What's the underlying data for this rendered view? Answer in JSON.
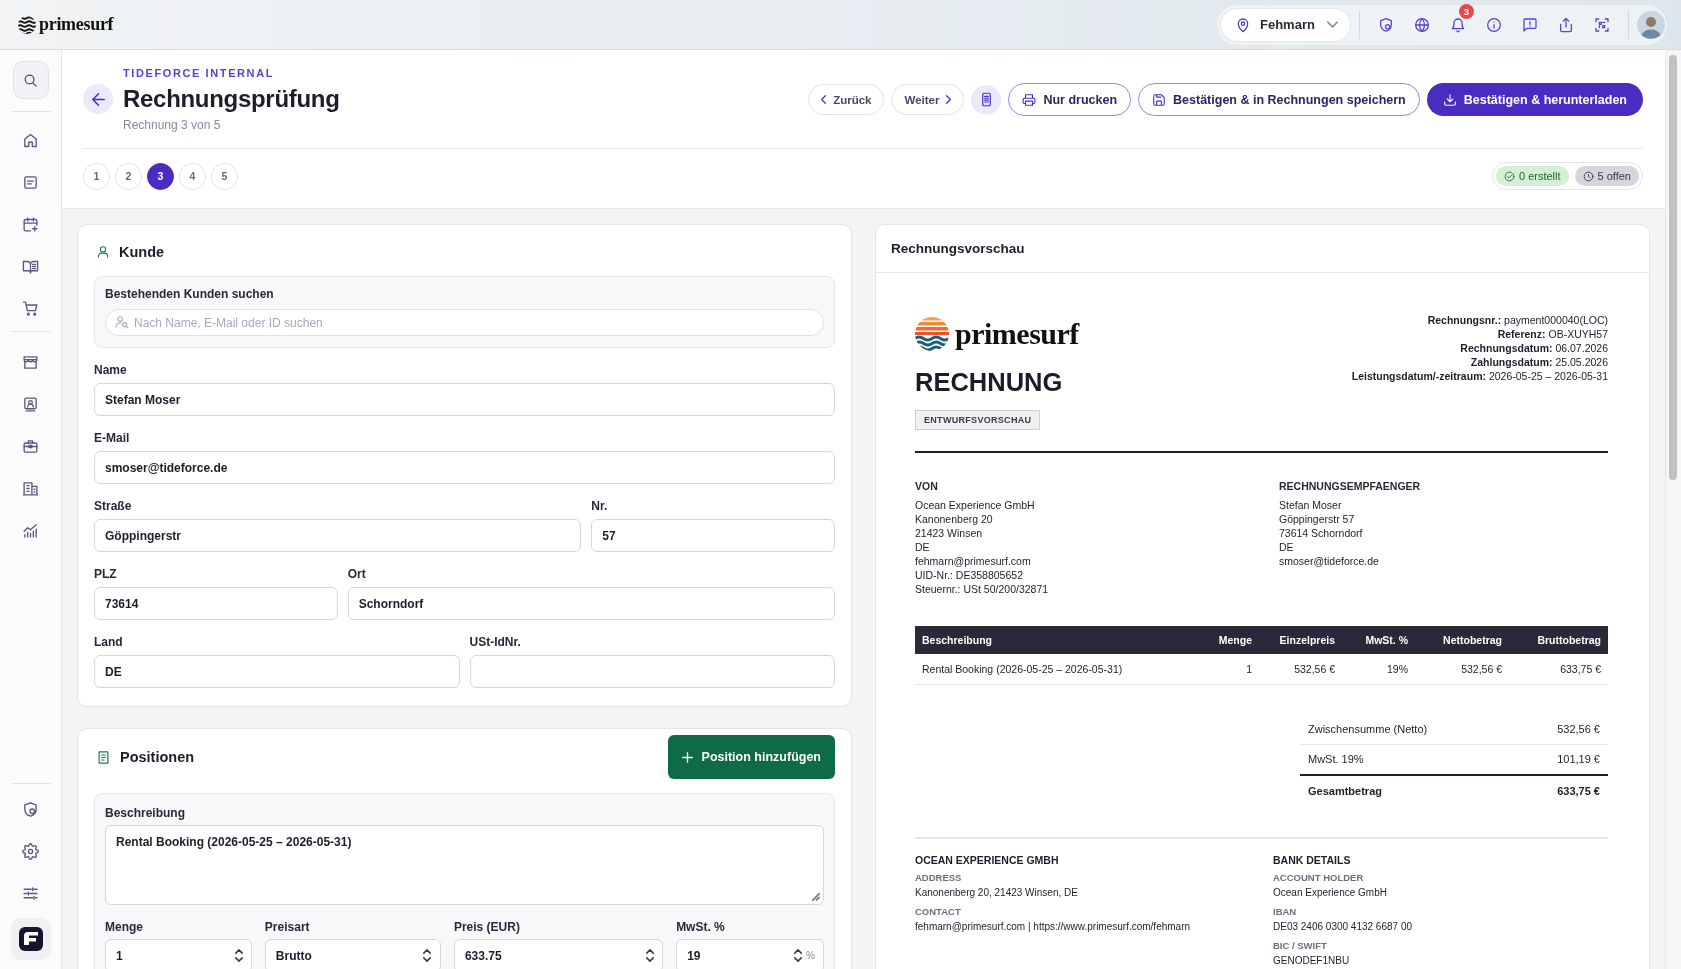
{
  "topbar": {
    "logo": "primesurf",
    "location": "Fehmarn",
    "notification_count": "3"
  },
  "header": {
    "eyebrow": "TIDEFORCE INTERNAL",
    "title": "Rechnungsprüfung",
    "subtitle": "Rechnung 3 von 5",
    "actions": [
      {
        "kind": "back",
        "label": "Zurück"
      },
      {
        "kind": "next",
        "label": "Weiter"
      },
      {
        "kind": "document"
      },
      {
        "kind": "print",
        "label": "Nur drucken"
      },
      {
        "kind": "save",
        "label": "Bestätigen & in Rechnungen speichern"
      },
      {
        "kind": "download",
        "label": "Bestätigen & herunterladen"
      }
    ],
    "pages": [
      {
        "label": "1",
        "selected": false
      },
      {
        "label": "2",
        "selected": false
      },
      {
        "label": "3",
        "selected": true
      },
      {
        "label": "4",
        "selected": false
      },
      {
        "label": "5",
        "selected": false
      }
    ],
    "status": [
      {
        "kind": "created",
        "label": "0 erstellt"
      },
      {
        "kind": "open",
        "label": "5 offen"
      }
    ]
  },
  "customer": {
    "title": "Kunde",
    "search": {
      "label": "Bestehenden Kunden suchen",
      "placeholder": "Nach Name, E-Mail oder ID suchen"
    },
    "rows": [
      [
        {
          "label": "Name",
          "value": "Stefan Moser"
        }
      ],
      [
        {
          "label": "E-Mail",
          "value": "smoser@tideforce.de"
        }
      ],
      [
        {
          "label": "Straße",
          "value": "Göppingerstr"
        },
        {
          "label": "Nr.",
          "value": "57"
        }
      ],
      [
        {
          "label": "PLZ",
          "value": "73614"
        },
        {
          "label": "Ort",
          "value": "Schorndorf"
        }
      ],
      [
        {
          "label": "Land",
          "value": "DE"
        },
        {
          "label": "USt-IdNr."
        }
      ]
    ]
  },
  "positions": {
    "title": "Positionen",
    "add_button": "Position hinzufügen",
    "item": {
      "description_label": "Beschreibung",
      "description": "Rental Booking (2026-05-25 – 2026-05-31)",
      "fields": [
        {
          "kind": "number",
          "label": "Menge",
          "value": "1"
        },
        {
          "kind": "select",
          "label": "Preisart",
          "value": "Brutto"
        },
        {
          "kind": "number",
          "label": "Preis (EUR)",
          "value": "633.75"
        },
        {
          "kind": "percent",
          "label": "MwSt. %",
          "value": "19",
          "unit": "%"
        }
      ]
    }
  },
  "preview": {
    "title": "Rechnungsvorschau",
    "logo": "primesurf",
    "heading": "RECHNUNG",
    "badge": "ENTWURFSVORSCHAU",
    "meta": [
      {
        "label": "Rechnungsnr.:",
        "value": "payment000040(LOC)"
      },
      {
        "label": "Referenz:",
        "value": "OB-XUYH57"
      },
      {
        "label": "Rechnungsdatum:",
        "value": "06.07.2026"
      },
      {
        "label": "Zahlungsdatum:",
        "value": "25.05.2026"
      },
      {
        "label": "Leistungsdatum/-zeitraum:",
        "value": "2026-05-25 – 2026-05-31"
      }
    ],
    "parties": [
      {
        "heading": "VON",
        "lines": [
          "Ocean Experience GmbH",
          "Kanonenberg 20",
          "21423 Winsen",
          "DE",
          "fehmarn@primesurf.com",
          "UID-Nr.: DE358805652",
          "Steuernr.: USt 50/200/32871"
        ]
      },
      {
        "heading": "RECHNUNGSEMPFAENGER",
        "lines": [
          "Stefan Moser",
          "Göppingerstr 57",
          "73614 Schorndorf",
          "DE",
          "smoser@tideforce.de"
        ]
      }
    ],
    "table": {
      "columns": [
        "Beschreibung",
        "Menge",
        "Einzelpreis",
        "MwSt. %",
        "Nettobetrag",
        "Bruttobetrag"
      ],
      "rows": [
        [
          "Rental Booking (2026-05-25 – 2026-05-31)",
          "1",
          "532,56 €",
          "19%",
          "532,56 €",
          "633,75 €"
        ]
      ]
    },
    "totals": [
      {
        "kind": "line",
        "label": "Zwischensumme (Netto)",
        "value": "532,56 €"
      },
      {
        "kind": "line",
        "label": "MwSt. 19%",
        "value": "101,19 €"
      },
      {
        "kind": "total",
        "label": "Gesamtbetrag",
        "value": "633,75 €"
      }
    ],
    "footer": [
      {
        "heading": "OCEAN EXPERIENCE GMBH",
        "entries": [
          {
            "label": "ADDRESS",
            "value": "Kanonenberg 20, 21423 Winsen, DE"
          },
          {
            "label": "CONTACT",
            "value": "fehmarn@primesurf.com | https://www.primesurf.com/fehmarn"
          }
        ]
      },
      {
        "heading": "BANK DETAILS",
        "entries": [
          {
            "label": "ACCOUNT HOLDER",
            "value": "Ocean Experience GmbH"
          },
          {
            "label": "IBAN",
            "value": "DE03 2406 0300 4132 6687 00"
          },
          {
            "label": "BIC / SWIFT",
            "value": "GENODEF1NBU"
          }
        ]
      }
    ]
  }
}
